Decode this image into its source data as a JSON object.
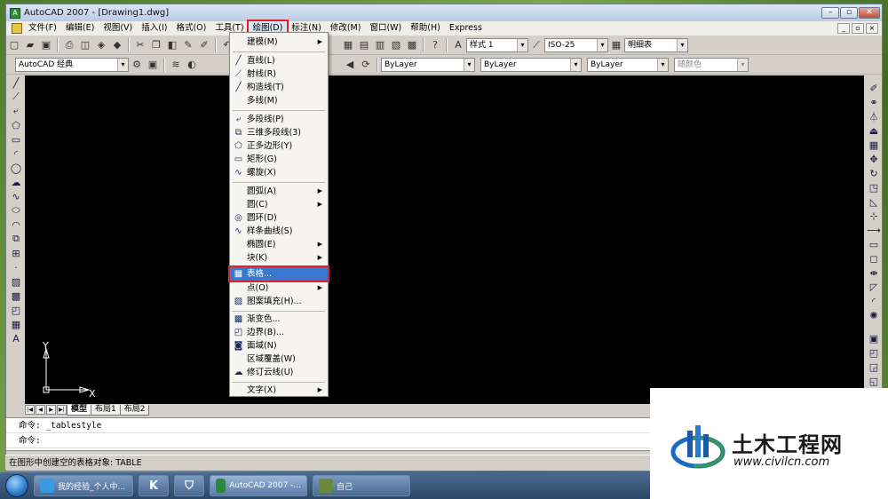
{
  "window": {
    "title": "AutoCAD 2007 - [Drawing1.dwg]"
  },
  "menubar": {
    "items": [
      "文件(F)",
      "编辑(E)",
      "视图(V)",
      "插入(I)",
      "格式(O)",
      "工具(T)",
      "绘图(D)",
      "标注(N)",
      "修改(M)",
      "窗口(W)",
      "帮助(H)",
      "Express"
    ]
  },
  "toolbar1": {
    "text_style_label": "样式 1",
    "dim_style_value": "ISO-25",
    "table_style_value": "明细表"
  },
  "toolbar2": {
    "workspace_value": "AutoCAD 经典",
    "color_value": "ByLayer",
    "linetype_value": "ByLayer",
    "lineweight_value": "ByLayer",
    "plotstyle_value": "随颜色"
  },
  "draw_menu": {
    "items": [
      {
        "label": "建模(M)",
        "submenu": true
      },
      {
        "label": "直线(L)"
      },
      {
        "label": "射线(R)"
      },
      {
        "label": "构造线(T)"
      },
      {
        "label": "多线(M)"
      },
      {
        "label": "多段线(P)"
      },
      {
        "label": "三维多段线(3)"
      },
      {
        "label": "正多边形(Y)"
      },
      {
        "label": "矩形(G)"
      },
      {
        "label": "螺旋(X)"
      },
      {
        "label": "圆弧(A)",
        "submenu": true
      },
      {
        "label": "圆(C)",
        "submenu": true
      },
      {
        "label": "圆环(D)"
      },
      {
        "label": "样条曲线(S)"
      },
      {
        "label": "椭圆(E)",
        "submenu": true
      },
      {
        "label": "块(K)",
        "submenu": true
      },
      {
        "label": "表格..."
      },
      {
        "label": "点(O)",
        "submenu": true
      },
      {
        "label": "图案填充(H)..."
      },
      {
        "label": "渐变色..."
      },
      {
        "label": "边界(B)..."
      },
      {
        "label": "面域(N)"
      },
      {
        "label": "区域覆盖(W)"
      },
      {
        "label": "修订云线(U)"
      },
      {
        "label": "文字(X)",
        "submenu": true
      }
    ],
    "highlighted": "表格..."
  },
  "ucs": {
    "x_label": "X",
    "y_label": "Y"
  },
  "layout_tabs": [
    "模型",
    "布局1",
    "布局2"
  ],
  "command": {
    "line1": "命令:  _tablestyle",
    "line2": "命令:"
  },
  "status": {
    "text": "在图形中创建空的表格对象:  TABLE"
  },
  "taskbar": {
    "buttons": [
      "我的经验_个人中...",
      "AutoCAD 2007 -...",
      "自己"
    ]
  },
  "watermark": {
    "title": "土木工程网",
    "url": "www.civilcn.com"
  },
  "colors": {
    "highlight_red": "#e0202a",
    "menu_selection_blue": "#3a78d0",
    "drawing_bg": "#000000"
  }
}
